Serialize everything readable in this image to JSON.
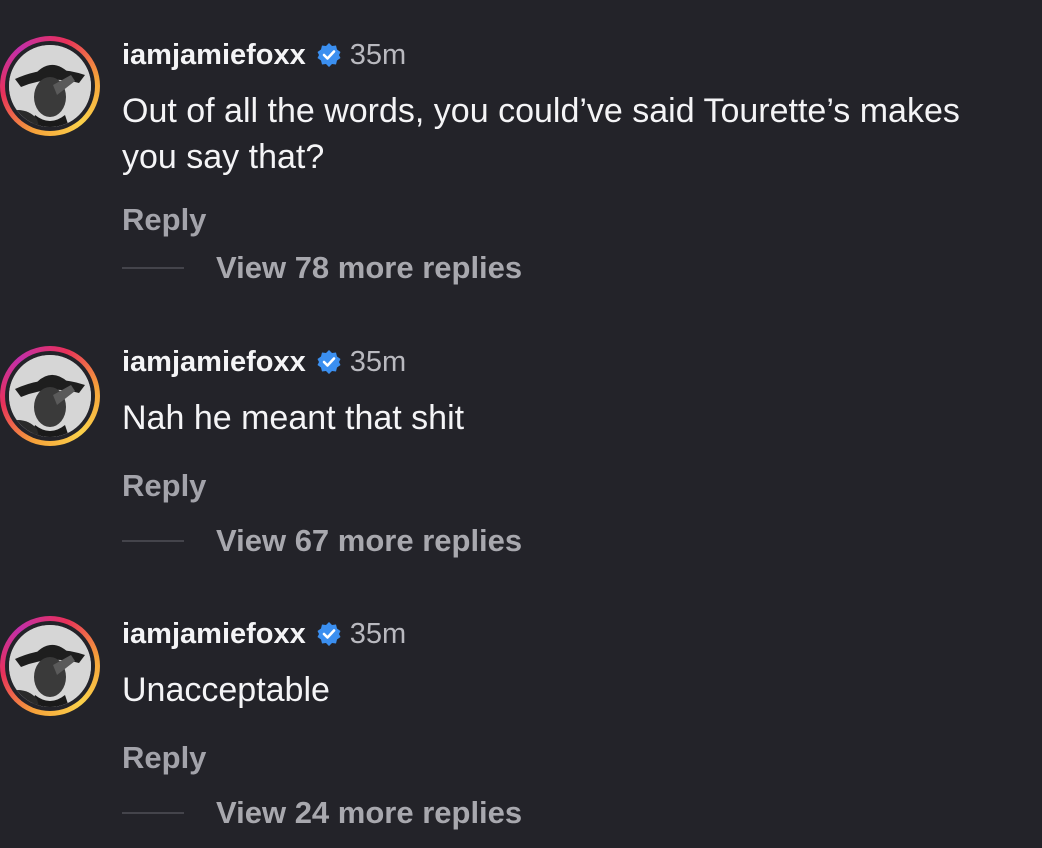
{
  "comments": [
    {
      "username": "iamjamiefoxx",
      "time": "35m",
      "text": "Out of all the words, you could’ve said Tourette’s makes you say that?",
      "reply_label": "Reply",
      "view_replies": "View 78 more replies",
      "verified": true
    },
    {
      "username": "iamjamiefoxx",
      "time": "35m",
      "text": "Nah he meant that shit",
      "reply_label": "Reply",
      "view_replies": "View 67 more replies",
      "verified": true
    },
    {
      "username": "iamjamiefoxx",
      "time": "35m",
      "text": "Unacceptable",
      "reply_label": "Reply",
      "view_replies": "View 24 more replies",
      "verified": true
    }
  ],
  "colors": {
    "background": "#232329",
    "verified_badge": "#3b8ff0",
    "story_ring_start": "#f6a23a",
    "story_ring_end": "#c22fa8"
  },
  "icons": {
    "verified": "verified-badge-icon",
    "avatar": "profile-avatar"
  }
}
